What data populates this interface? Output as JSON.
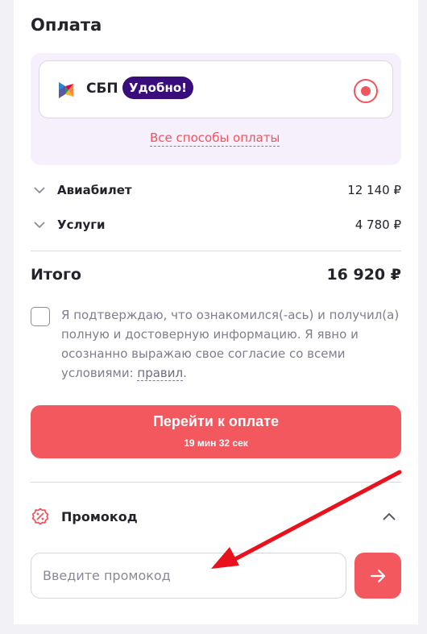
{
  "payment": {
    "title": "Оплата",
    "method_label": "СБП",
    "method_badge": "Удобно!",
    "all_methods_link": "Все способы оплаты"
  },
  "breakdown": [
    {
      "label": "Авиабилет",
      "value": "12 140 ₽"
    },
    {
      "label": "Услуги",
      "value": "4 780 ₽"
    }
  ],
  "total": {
    "label": "Итого",
    "value": "16 920 ₽"
  },
  "consent": {
    "text": "Я подтверждаю, что ознакомился(-ась) и получил(а) полную и достоверную информацию. Я явно и осознанно выражаю свое согласие со всеми условиями: ",
    "link": "правил",
    "suffix": "."
  },
  "pay_button": {
    "label": "Перейти к оплате",
    "timer": "19 мин 32 сек"
  },
  "promo": {
    "title": "Промокод",
    "placeholder": "Введите промокод"
  },
  "colors": {
    "accent": "#f3585e",
    "badge": "#3a0e7a",
    "pay_box": "#f5f0fc",
    "annotation_arrow": "#e8111c"
  }
}
